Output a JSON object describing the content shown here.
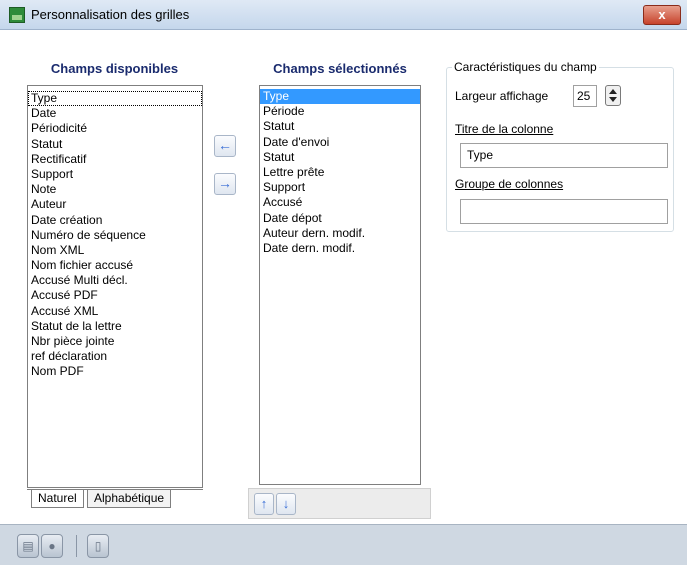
{
  "window": {
    "title": "Personnalisation des grilles",
    "close_label": "x"
  },
  "available": {
    "header": "Champs disponibles",
    "items": [
      "Type",
      "Date",
      "Périodicité",
      "Statut",
      "Rectificatif",
      "Support",
      "Note",
      "Auteur",
      "Date création",
      "Numéro de séquence",
      "Nom XML",
      "Nom fichier accusé",
      "Accusé Multi décl.",
      "Accusé PDF",
      "Accusé XML",
      "Statut de la lettre",
      "Nbr pièce jointe",
      "ref déclaration",
      "Nom PDF"
    ]
  },
  "selected": {
    "header": "Champs sélectionnés",
    "items": [
      "Type",
      "Période",
      "Statut",
      "Date d'envoi",
      "Statut",
      "Lettre prête",
      "Support",
      "Accusé",
      "Date dépot",
      "Auteur dern. modif.",
      "Date dern. modif."
    ]
  },
  "move": {
    "left_icon": "arrow-left-icon",
    "right_icon": "arrow-right-icon"
  },
  "tabs": {
    "naturel": "Naturel",
    "alpha": "Alphabétique"
  },
  "order": {
    "up_icon": "arrow-up-icon",
    "down_icon": "arrow-down-icon"
  },
  "properties": {
    "group_title": "Caractéristiques du champ",
    "width_label": "Largeur affichage",
    "width_value": "25",
    "title_label": "Titre de la colonne",
    "title_value": "Type",
    "group_label": "Groupe de colonnes",
    "group_value": ""
  },
  "colors": {
    "accent": "#3399ff",
    "header": "#1a2b6e"
  }
}
